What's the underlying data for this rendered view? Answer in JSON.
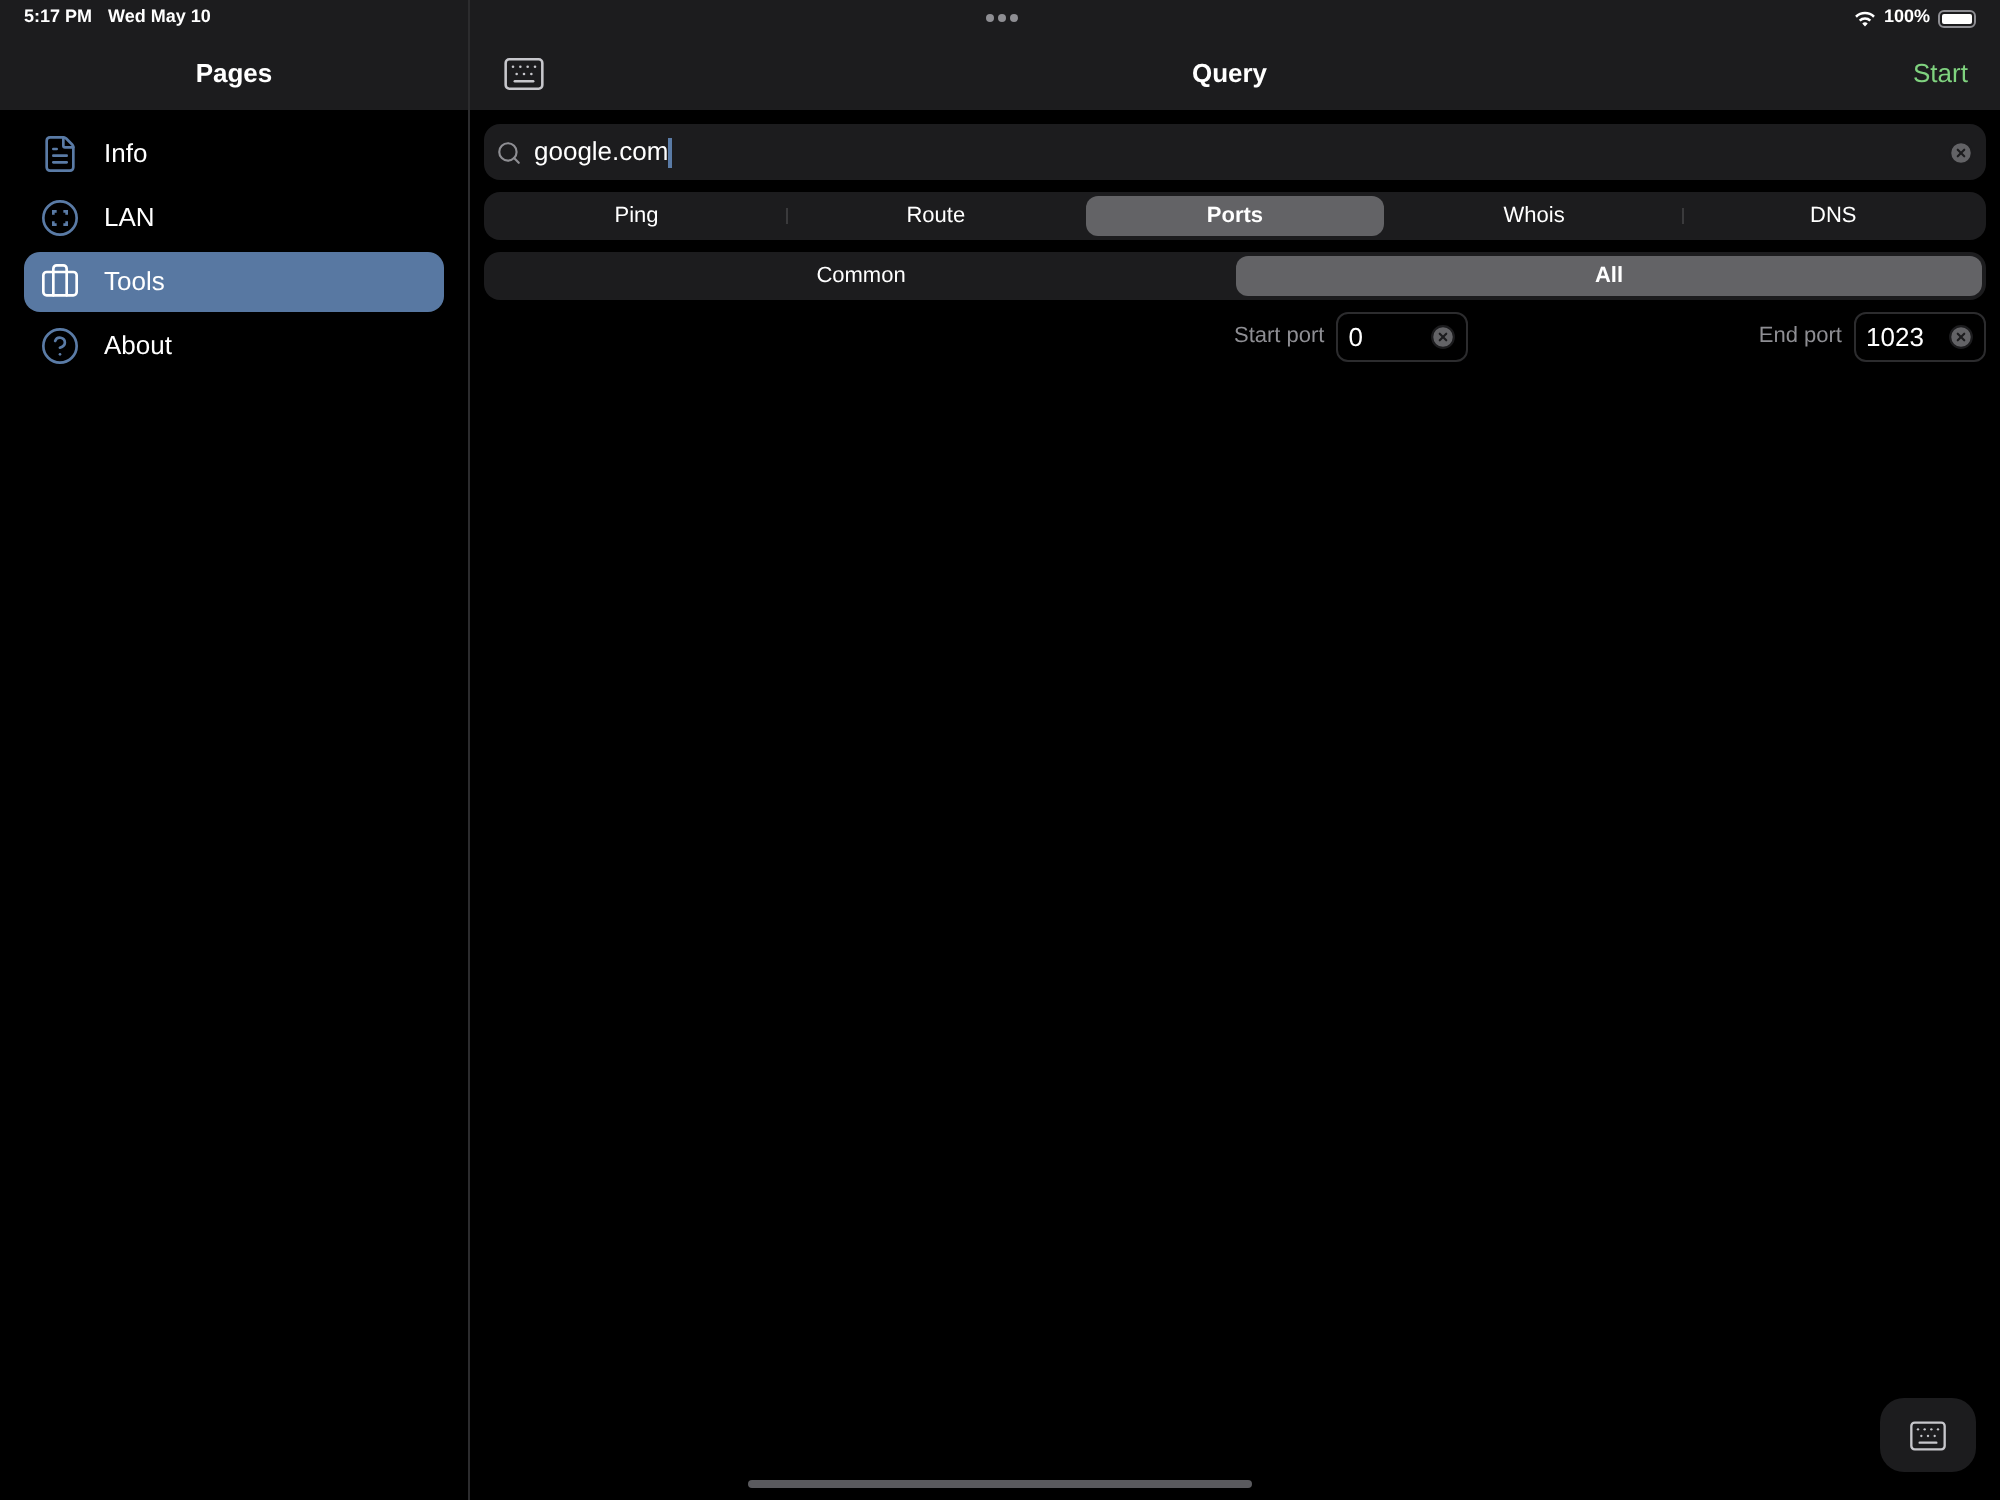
{
  "status_bar": {
    "time": "5:17 PM",
    "date": "Wed May 10",
    "battery": "100%"
  },
  "sidebar": {
    "title": "Pages",
    "items": [
      {
        "label": "Info",
        "kind": "document",
        "selected": false
      },
      {
        "label": "LAN",
        "kind": "scan",
        "selected": false
      },
      {
        "label": "Tools",
        "kind": "briefcase",
        "selected": true
      },
      {
        "label": "About",
        "kind": "help",
        "selected": false
      }
    ]
  },
  "main": {
    "title": "Query",
    "action": "Start",
    "search": {
      "value": "google.com"
    },
    "tabs": [
      {
        "label": "Ping",
        "selected": false
      },
      {
        "label": "Route",
        "selected": false
      },
      {
        "label": "Ports",
        "selected": true
      },
      {
        "label": "Whois",
        "selected": false
      },
      {
        "label": "DNS",
        "selected": false
      }
    ],
    "modes": [
      {
        "label": "Common",
        "selected": false
      },
      {
        "label": "All",
        "selected": true
      }
    ],
    "ports": [
      {
        "label": "Start port",
        "value": "0"
      },
      {
        "label": "End port",
        "value": "1023"
      }
    ]
  }
}
